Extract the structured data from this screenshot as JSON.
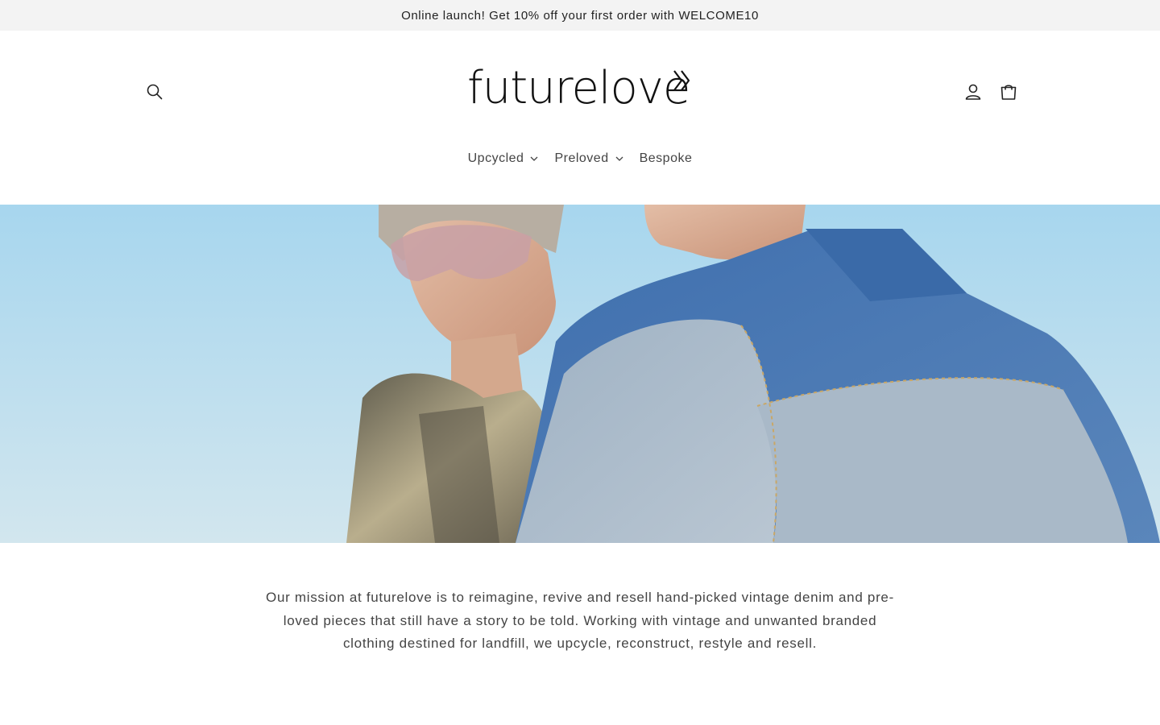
{
  "announcement": "Online launch! Get 10% off your first order with WELCOME10",
  "brand": {
    "name": "futurelove"
  },
  "icons": {
    "search": "search-icon",
    "account": "account-icon",
    "cart": "cart-icon",
    "chevron": "chevron-down-icon"
  },
  "nav": {
    "items": [
      {
        "label": "Upcycled",
        "has_dropdown": true
      },
      {
        "label": "Preloved",
        "has_dropdown": true
      },
      {
        "label": "Bespoke",
        "has_dropdown": false
      }
    ]
  },
  "hero": {
    "alt": ""
  },
  "mission": {
    "text": "Our mission at futurelove is to reimagine, revive and resell hand-picked vintage denim and pre-loved pieces that still have a story to be told. Working with vintage and unwanted branded clothing destined for landfill, we upcycle, reconstruct, restyle and resell."
  },
  "colors": {
    "announcement_bg": "#f3f3f3",
    "text": "#444444",
    "sky": "#a9d7ee",
    "denim": "#4f7fb8"
  }
}
